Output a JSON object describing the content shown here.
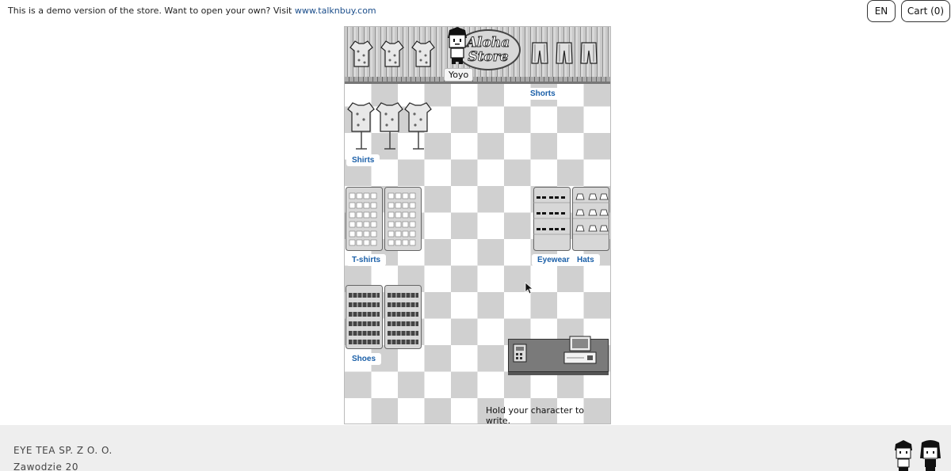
{
  "banner": {
    "text": "This is a demo version of the store. Want to open your own? Visit ",
    "link": "www.talknbuy.com"
  },
  "header": {
    "lang_label": "EN",
    "cart_label": "Cart (0)"
  },
  "store": {
    "sign_line1": "Aloha",
    "sign_line2": "Store",
    "character_name": "Yoyo",
    "sections": {
      "shorts": "Shorts",
      "shirts": "Shirts",
      "tshirts": "T-shirts",
      "eyewear": "Eyewear",
      "hats": "Hats",
      "shoes": "Shoes"
    },
    "hint": "Hold your character to write."
  },
  "footer": {
    "company": "EYE TEA SP. Z O. O.",
    "address": "Zawodzie 20"
  }
}
